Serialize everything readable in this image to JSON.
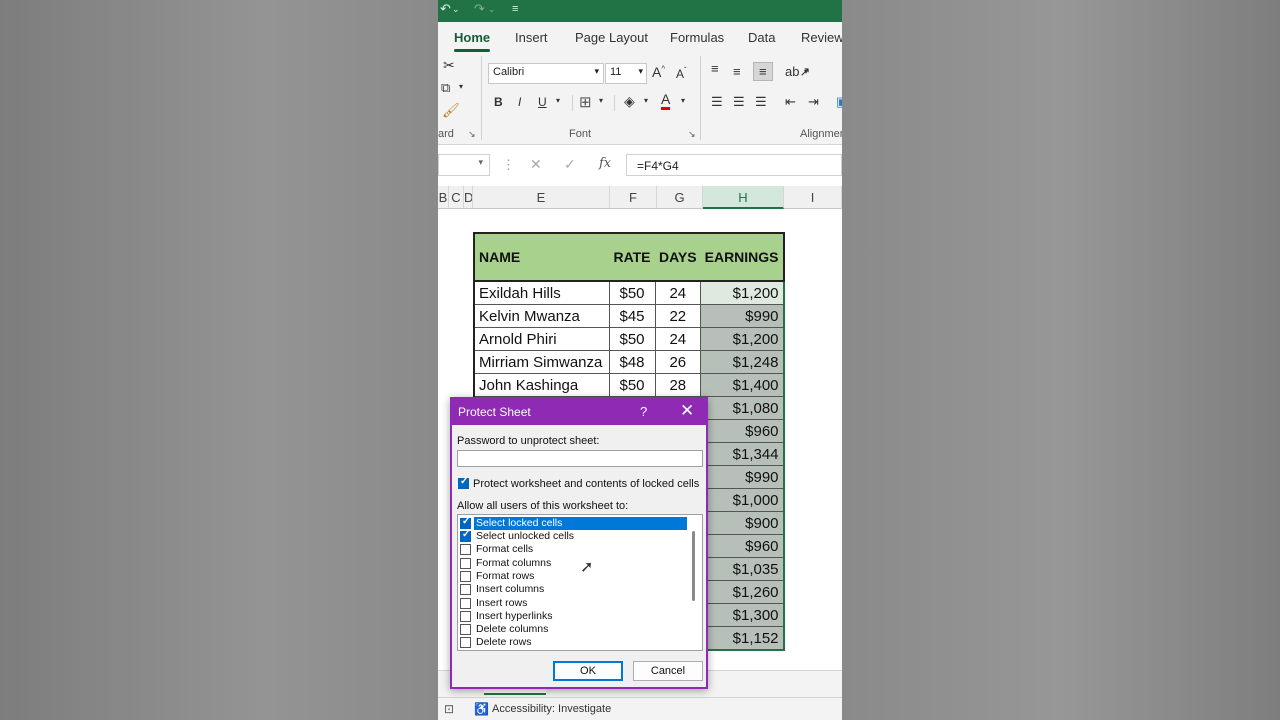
{
  "ribbon": {
    "tabs": [
      "Home",
      "Insert",
      "Page Layout",
      "Formulas",
      "Data",
      "Review"
    ],
    "active_tab": "Home",
    "font_name": "Calibri",
    "font_size": "11",
    "groups": {
      "clipboard": "ard",
      "font": "Font",
      "alignment": "Alignmen"
    },
    "font_color": "#e00000"
  },
  "formula_bar": {
    "fx": "fx",
    "formula": "=F4*G4"
  },
  "columns": [
    "B",
    "C",
    "D",
    "E",
    "F",
    "G",
    "H",
    "I"
  ],
  "table": {
    "headers": [
      "NAME",
      "RATE",
      "DAYS",
      "EARNINGS"
    ],
    "rows": [
      {
        "name": "Exildah Hills",
        "rate": "$50",
        "days": "24",
        "earnings": "$1,200"
      },
      {
        "name": "Kelvin Mwanza",
        "rate": "$45",
        "days": "22",
        "earnings": "$990"
      },
      {
        "name": "Arnold Phiri",
        "rate": "$50",
        "days": "24",
        "earnings": "$1,200"
      },
      {
        "name": "Mirriam Simwanza",
        "rate": "$48",
        "days": "26",
        "earnings": "$1,248"
      },
      {
        "name": "John Kashinga",
        "rate": "$50",
        "days": "28",
        "earnings": "$1,400"
      }
    ],
    "visible_earnings": [
      "$1,080",
      "$960",
      "$1,344",
      "$990",
      "$1,000",
      "$900",
      "$960",
      "$1,035",
      "$1,260",
      "$1,300",
      "$1,152"
    ],
    "header_color": "#a9d18e"
  },
  "dialog": {
    "title": "Protect Sheet",
    "help": "?",
    "close": "✕",
    "password_label": "Password to unprotect sheet:",
    "protect_label": "Protect worksheet and contents of locked cells",
    "allow_label": "Allow all users of this worksheet to:",
    "permissions": [
      {
        "label": "Select locked cells",
        "checked": true
      },
      {
        "label": "Select unlocked cells",
        "checked": true
      },
      {
        "label": "Format cells",
        "checked": false
      },
      {
        "label": "Format columns",
        "checked": false
      },
      {
        "label": "Format rows",
        "checked": false
      },
      {
        "label": "Insert columns",
        "checked": false
      },
      {
        "label": "Insert rows",
        "checked": false
      },
      {
        "label": "Insert hyperlinks",
        "checked": false
      },
      {
        "label": "Delete columns",
        "checked": false
      },
      {
        "label": "Delete rows",
        "checked": false
      }
    ],
    "ok": "OK",
    "cancel": "Cancel",
    "accent": "#8e2ab3"
  },
  "status": {
    "accessibility": "Accessibility: Investigate"
  }
}
